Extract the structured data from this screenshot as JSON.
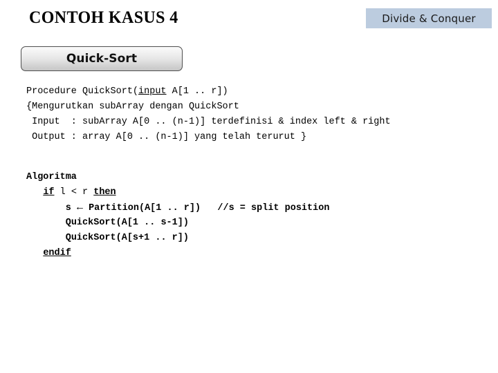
{
  "slide": {
    "title": "CONTOH KASUS 4",
    "background_color": "#ffffff"
  },
  "badge": {
    "label": "Divide & Conquer",
    "background_color": "#bcccdf",
    "text_color": "#1a1a1a"
  },
  "button": {
    "label": "Quick-Sort",
    "border_color": "#4d4d4d",
    "gradient_top": "#fbfbfb",
    "gradient_bottom": "#c6c6c6"
  },
  "pseudocode": {
    "header": {
      "line1_prefix": "Procedure QuickSort(",
      "line1_keyword": "input",
      "line1_suffix": " A[1 .. r])",
      "line2": "{Mengurutkan subArray dengan QuickSort",
      "line3": " Input  : subArray A[0 .. (n-1)] terdefinisi & index left & right",
      "line4": " Output : array A[0 .. (n-1)] yang telah terurut }"
    },
    "body": {
      "algoritma": "Algoritma",
      "if_keyword": "if",
      "if_condition": " l < r ",
      "then_keyword": "then",
      "assign_var": "s",
      "assign_arrow": "←",
      "assign_call": "Partition(A[1 .. r])",
      "assign_comment": "//s = split position",
      "recurse_left": "QuickSort(A[1 .. s-1])",
      "recurse_right": "QuickSort(A[s+1 .. r])",
      "endif_keyword": "endif"
    }
  }
}
